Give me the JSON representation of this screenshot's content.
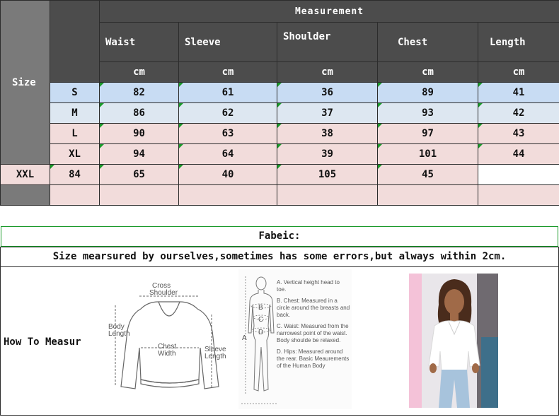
{
  "table": {
    "size_header": "Size",
    "measurement_header": "Measurement",
    "columns": [
      "Waist",
      "Sleeve",
      "Shoulder",
      "Chest",
      "Length"
    ],
    "unit": "cm",
    "rows": [
      {
        "size": "S",
        "values": [
          "82",
          "61",
          "36",
          "89",
          "41"
        ]
      },
      {
        "size": "M",
        "values": [
          "86",
          "62",
          "37",
          "93",
          "42"
        ]
      },
      {
        "size": "L",
        "values": [
          "90",
          "63",
          "38",
          "97",
          "43"
        ]
      },
      {
        "size": "XL",
        "values": [
          "94",
          "64",
          "39",
          "101",
          "44"
        ]
      },
      {
        "size": "XXL",
        "values": [
          "84",
          "65",
          "40",
          "105",
          "45"
        ]
      }
    ]
  },
  "fabric_label": "Fabeic:",
  "note": "Size mearsured by ourselves,sometimes has some errors,but always within 2cm.",
  "how_to": {
    "label": "How To Measur",
    "shirt_labels": {
      "cross_shoulder_1": "Cross",
      "cross_shoulder_2": "Shoulder",
      "body_length_1": "Body",
      "body_length_2": "Length",
      "chest_width_1": "Chest",
      "chest_width_2": "Width",
      "sleeve_length_1": "Sleeve",
      "sleeve_length_2": "Length"
    },
    "body_markers": {
      "a": "A",
      "b": "B",
      "c": "C",
      "d": "D"
    },
    "body_notes": [
      "A. Vertical height head to toe.",
      "B. Chest: Measured in a circle around the breasts and back.",
      "C. Waist: Measured from the narrowest point of the waist. Body shoulde be relaxed.",
      "D. Hips: Measured around the rear. Basic Meaurements of the Human Body"
    ]
  },
  "colors": {
    "header_dark": "#4c4c4c",
    "size_col": "#7a7a7a",
    "row_blue": "#c8dcf3",
    "row_blue_light": "#dde7f1",
    "row_pink": "#f2dcdb",
    "fabric_border": "#1a9a2a"
  }
}
